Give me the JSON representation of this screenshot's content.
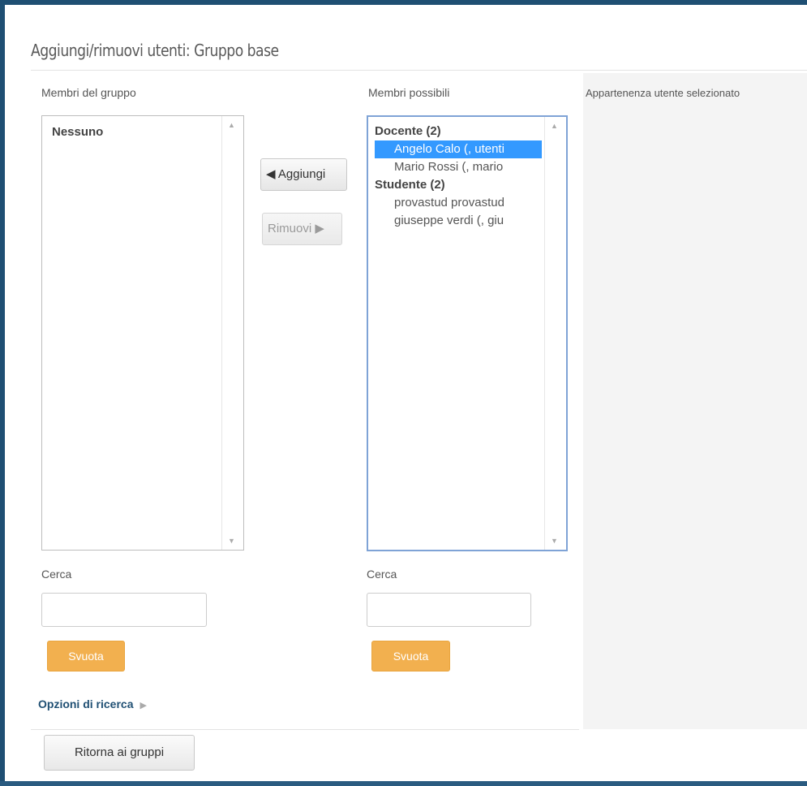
{
  "page": {
    "title": "Aggiungi/rimuovi utenti: Gruppo base"
  },
  "group_members": {
    "label": "Membri del gruppo",
    "empty_text": "Nessuno",
    "search_label": "Cerca",
    "search_value": "",
    "clear_label": "Svuota"
  },
  "actions": {
    "add_label": "◀ Aggiungi",
    "remove_label": "Rimuovi ▶"
  },
  "potential_members": {
    "label": "Membri possibili",
    "groups": [
      {
        "label": "Docente (2)",
        "options": [
          {
            "label": "Angelo Calo (, utenti",
            "selected": true
          },
          {
            "label": "Mario Rossi (, mario",
            "selected": false
          }
        ]
      },
      {
        "label": "Studente (2)",
        "options": [
          {
            "label": "provastud provastud",
            "selected": false
          },
          {
            "label": "giuseppe verdi (, giu",
            "selected": false
          }
        ]
      }
    ],
    "search_label": "Cerca",
    "search_value": "",
    "clear_label": "Svuota"
  },
  "selected_user": {
    "label": "Appartenenza utente selezionato"
  },
  "search_options": {
    "label": "Opzioni di ricerca"
  },
  "footer": {
    "back_label": "Ritorna ai gruppi"
  },
  "colors": {
    "frame": "#1f4f73",
    "accent_orange": "#f2b04f",
    "selection_blue": "#3399ff",
    "focus_border": "#7fa3d6",
    "link_blue": "#1f4f73"
  }
}
